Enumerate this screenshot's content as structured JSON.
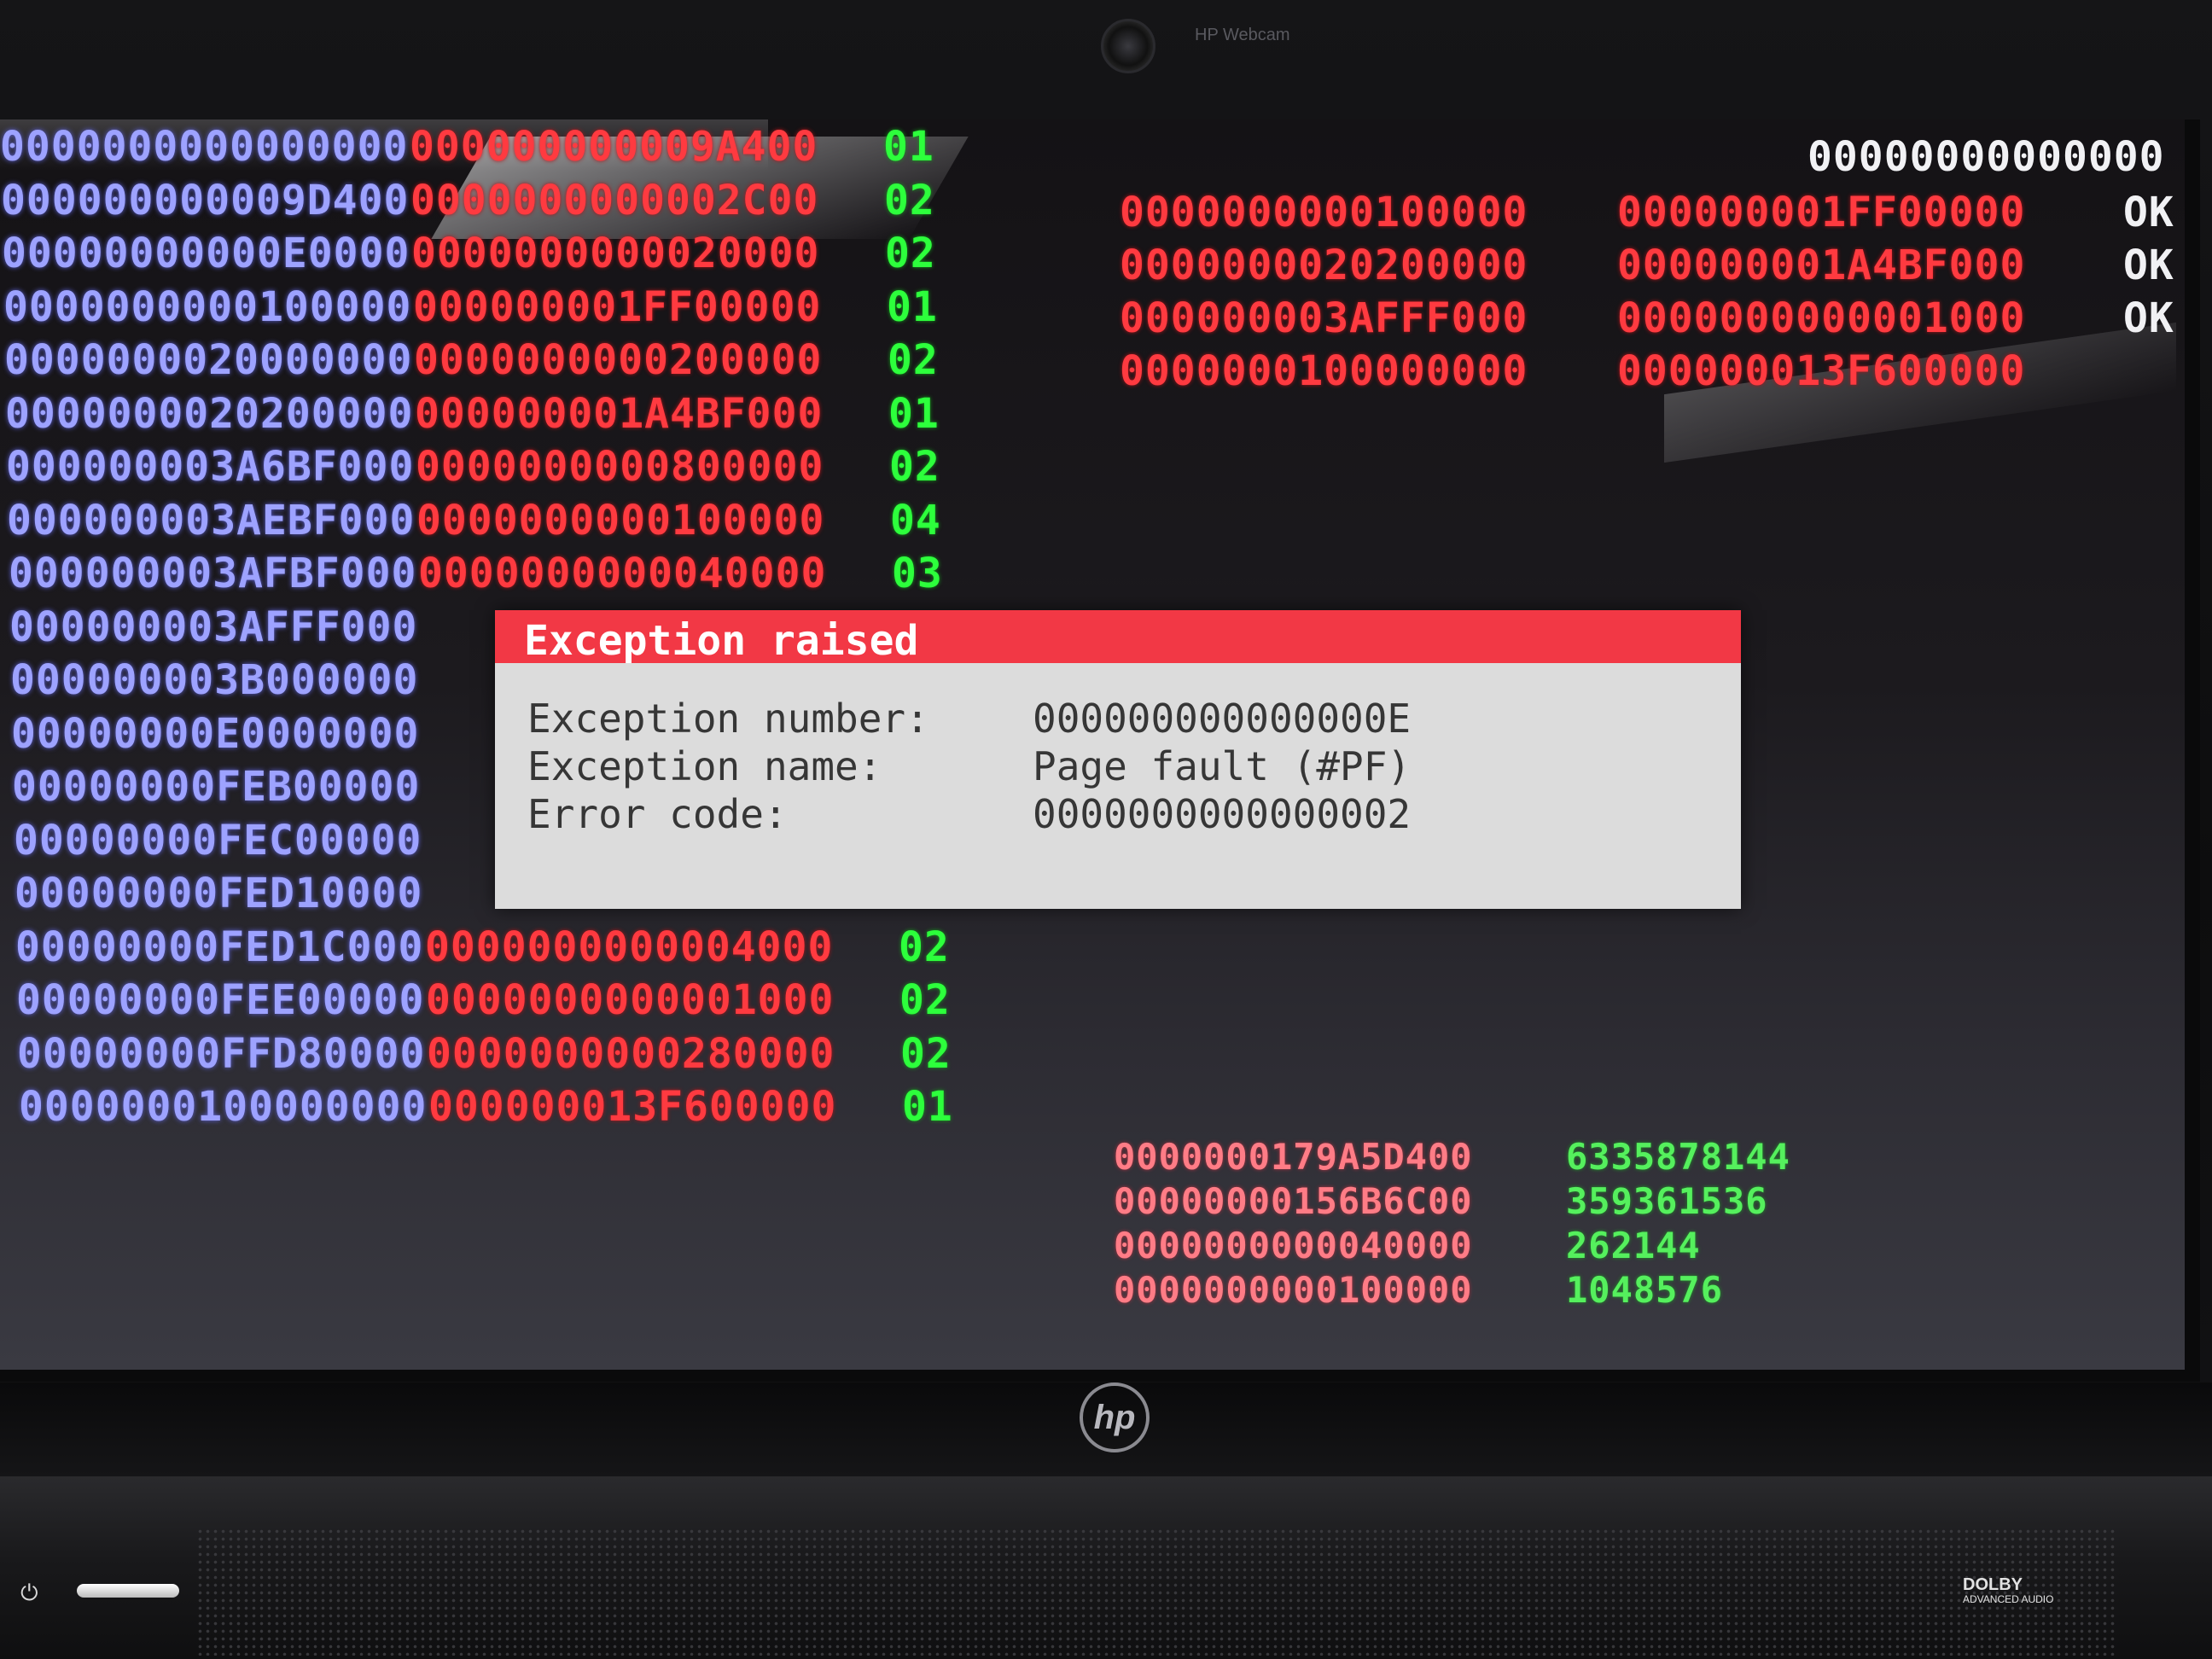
{
  "memory_map": [
    {
      "base": "0000000000000000",
      "length": "000000000009A400",
      "type": "01"
    },
    {
      "base": "000000000009D400",
      "length": "0000000000002C00",
      "type": "02"
    },
    {
      "base": "00000000000E0000",
      "length": "0000000000020000",
      "type": "02"
    },
    {
      "base": "0000000000100000",
      "length": "000000001FF00000",
      "type": "01"
    },
    {
      "base": "0000000020000000",
      "length": "0000000000200000",
      "type": "02"
    },
    {
      "base": "0000000020200000",
      "length": "000000001A4BF000",
      "type": "01"
    },
    {
      "base": "000000003A6BF000",
      "length": "0000000000800000",
      "type": "02"
    },
    {
      "base": "000000003AEBF000",
      "length": "0000000000100000",
      "type": "04"
    },
    {
      "base": "000000003AFBF000",
      "length": "0000000000040000",
      "type": "03"
    },
    {
      "base": "000000003AFFF000",
      "length": "",
      "type": ""
    },
    {
      "base": "000000003B000000",
      "length": "",
      "type": ""
    },
    {
      "base": "00000000E0000000",
      "length": "",
      "type": ""
    },
    {
      "base": "00000000FEB00000",
      "length": "",
      "type": ""
    },
    {
      "base": "00000000FEC00000",
      "length": "",
      "type": ""
    },
    {
      "base": "00000000FED10000",
      "length": "",
      "type": ""
    },
    {
      "base": "00000000FED1C000",
      "length": "0000000000004000",
      "type": "02"
    },
    {
      "base": "00000000FEE00000",
      "length": "0000000000001000",
      "type": "02"
    },
    {
      "base": "00000000FFD80000",
      "length": "0000000000280000",
      "type": "02"
    },
    {
      "base": "0000000100000000",
      "length": "000000013F600000",
      "type": "01"
    }
  ],
  "region_header": "00000000000000",
  "regions": [
    {
      "start": "0000000000100000",
      "size": "000000001FF00000",
      "status": "OK"
    },
    {
      "start": "0000000020200000",
      "size": "000000001A4BF000",
      "status": "OK"
    },
    {
      "start": "000000003AFFF000",
      "size": "0000000000001000",
      "status": "OK"
    },
    {
      "start": "0000000100000000",
      "size": "000000013F600000",
      "status": ""
    }
  ],
  "stats": [
    {
      "hex": "0000000179A5D400",
      "dec": "6335878144"
    },
    {
      "hex": "00000000156B6C00",
      "dec": "359361536"
    },
    {
      "hex": "0000000000040000",
      "dec": "262144"
    },
    {
      "hex": "0000000000100000",
      "dec": "1048576"
    }
  ],
  "dialog": {
    "title": "Exception raised",
    "number_label": "Exception number:",
    "number_value": "000000000000000E",
    "name_label": "Exception name:",
    "name_value": "Page fault (#PF)",
    "code_label": "Error code:",
    "code_value": "0000000000000002"
  },
  "hardware": {
    "brand_logo": "hp",
    "webcam_label": "HP Webcam",
    "audio_badge": "DOLBY",
    "audio_badge_sub": "ADVANCED AUDIO",
    "power_icon": "power-icon"
  },
  "colors": {
    "base_column": "#9da2ff",
    "length_column": "#ff3a40",
    "type_column": "#2dff3c",
    "dialog_title_bar": "#f23845",
    "dialog_body": "#dcdcdc"
  }
}
